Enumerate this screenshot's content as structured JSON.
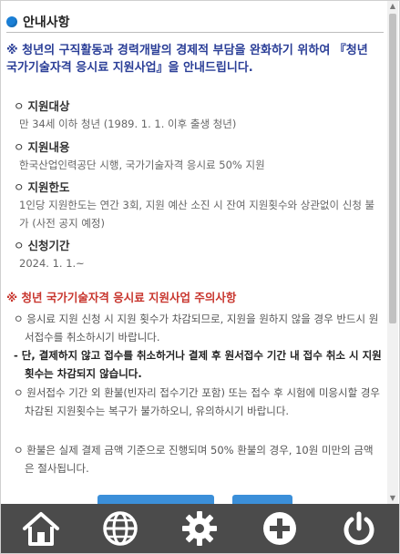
{
  "header": {
    "title": "안내사항"
  },
  "notice": "※ 청년의 구직활동과 경력개발의 경제적 부담을 완화하기 위하여 『청년 국가기술자격 응시료 지원사업』을 안내드립니다.",
  "sections": [
    {
      "title": "지원대상",
      "body": "만 34세 이하 청년 (1989. 1. 1. 이후 출생 청년)"
    },
    {
      "title": "지원내용",
      "body": "한국산업인력공단 시행, 국가기술자격 응시료 50% 지원"
    },
    {
      "title": "지원한도",
      "body": "1인당 지원한도는 연간 3회, 지원 예산 소진 시 잔여 지원횟수와 상관없이 신청 불가 (사전 공지 예정)"
    },
    {
      "title": "신청기간",
      "body": "2024. 1. 1.~"
    }
  ],
  "caution": {
    "title": "※ 청년 국가기술자격 응시료 지원사업 주의사항",
    "items": [
      "ㅇ 응시료 지원 신청 시 지원 횟수가 차감되므로, 지원을 원하지 않을 경우 반드시 원서접수를 취소하시기 바랍니다.",
      "ㅇ 원서접수 기간 외 환불(빈자리 접수기간 포함) 또는 접수 후 시험에 미응시할 경우 차감된 지원횟수는 복구가 불가하오니, 유의하시기 바랍니다.",
      "ㅇ 환불은 실제 결제 금액 기준으로 진행되며 50% 환불의 경우, 10원 미만의 금액은 절사됩니다."
    ],
    "note": "- 단, 결제하지 않고 접수를 취소하거나 결제 후 원서접수 기간 내 접수 취소 시 지원횟수는 차감되지 않습니다."
  },
  "bottom_nav": [
    {
      "icon": "home-icon"
    },
    {
      "icon": "globe-icon"
    },
    {
      "icon": "gear-icon"
    },
    {
      "icon": "plus-icon"
    },
    {
      "icon": "power-icon"
    }
  ],
  "colors": {
    "accent": "#1a7fd6",
    "notice": "#2a3e97",
    "caution": "#c8362e",
    "bar": "#4b4b4b"
  }
}
